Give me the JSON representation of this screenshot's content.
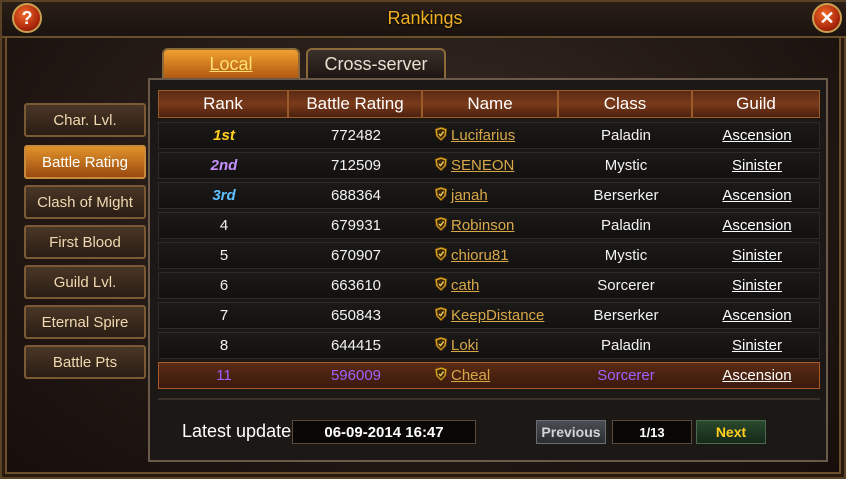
{
  "window": {
    "title": "Rankings",
    "help_label": "?",
    "close_label": "✕"
  },
  "tabs": [
    {
      "label": "Local",
      "active": true
    },
    {
      "label": "Cross-server",
      "active": false
    }
  ],
  "sidebar": {
    "items": [
      {
        "label": "Char. Lvl.",
        "active": false
      },
      {
        "label": "Battle Rating",
        "active": true
      },
      {
        "label": "Clash of Might",
        "active": false
      },
      {
        "label": "First Blood",
        "active": false
      },
      {
        "label": "Guild Lvl.",
        "active": false
      },
      {
        "label": "Eternal Spire",
        "active": false
      },
      {
        "label": "Battle Pts",
        "active": false
      }
    ]
  },
  "table": {
    "columns": [
      "Rank",
      "Battle Rating",
      "Name",
      "Class",
      "Guild"
    ],
    "rows": [
      {
        "rank": "1st",
        "rating": "772482",
        "name": "Lucifarius",
        "class": "Paladin",
        "guild": "Ascension"
      },
      {
        "rank": "2nd",
        "rating": "712509",
        "name": "SENEON",
        "class": "Mystic",
        "guild": "Sinister"
      },
      {
        "rank": "3rd",
        "rating": "688364",
        "name": "janah",
        "class": "Berserker",
        "guild": "Ascension"
      },
      {
        "rank": "4",
        "rating": "679931",
        "name": "Robinson",
        "class": "Paladin",
        "guild": "Ascension"
      },
      {
        "rank": "5",
        "rating": "670907",
        "name": "chioru81",
        "class": "Mystic",
        "guild": "Sinister"
      },
      {
        "rank": "6",
        "rating": "663610",
        "name": "cath",
        "class": "Sorcerer",
        "guild": "Sinister"
      },
      {
        "rank": "7",
        "rating": "650843",
        "name": "KeepDistance",
        "class": "Berserker",
        "guild": "Ascension"
      },
      {
        "rank": "8",
        "rating": "644415",
        "name": "Loki",
        "class": "Paladin",
        "guild": "Sinister"
      },
      {
        "rank": "11",
        "rating": "596009",
        "name": "Cheal",
        "class": "Sorcerer",
        "guild": "Ascension"
      }
    ]
  },
  "footer": {
    "update_label": "Latest update",
    "update_value": "06-09-2014 16:47",
    "prev_label": "Previous",
    "page_indicator": "1/13",
    "next_label": "Next"
  },
  "colors": {
    "accent_gold": "#f0b020",
    "rank1": "#ffd020",
    "rank2": "#c890ff",
    "rank3": "#60c0ff",
    "own_row": "#a060ff"
  },
  "icons": {
    "name_badge": "shield-icon"
  }
}
